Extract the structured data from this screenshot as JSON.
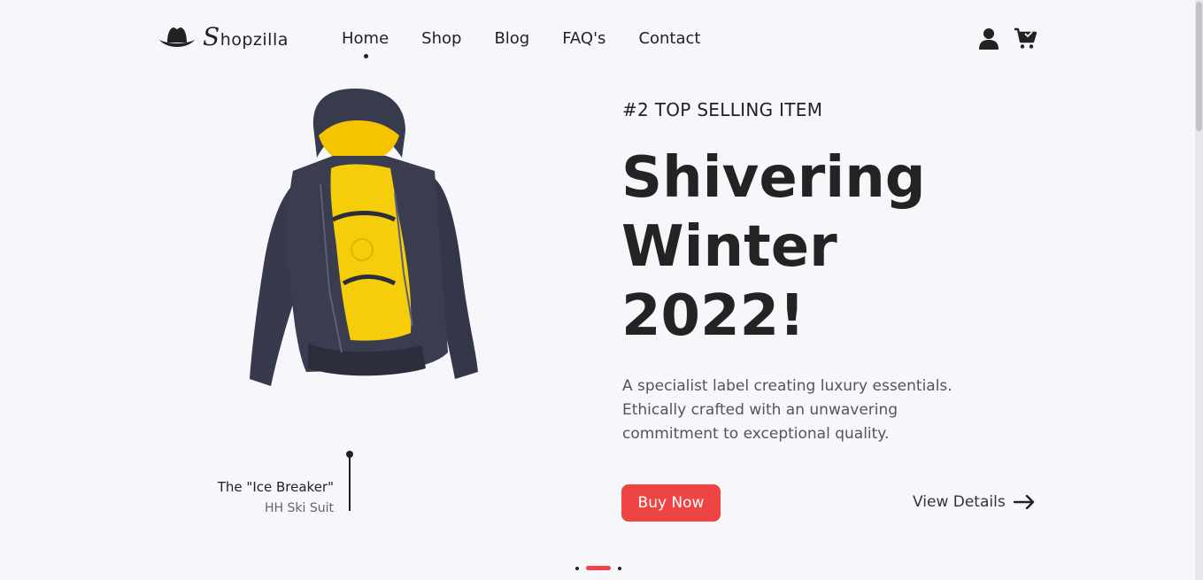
{
  "brand": {
    "logo_cap": "S",
    "logo_rest": "hopzilla"
  },
  "nav": [
    {
      "label": "Home",
      "active": true
    },
    {
      "label": "Shop",
      "active": false
    },
    {
      "label": "Blog",
      "active": false
    },
    {
      "label": "FAQ's",
      "active": false
    },
    {
      "label": "Contact",
      "active": false
    }
  ],
  "header_icons": [
    "hat-logo-icon",
    "user-icon",
    "cart-icon"
  ],
  "hero": {
    "eyebrow": "#2 TOP SELLING ITEM",
    "headline": [
      "Shivering",
      "Winter",
      "2022!"
    ],
    "description": [
      "A specialist label creating luxury essentials.",
      "Ethically crafted with an unwavering",
      "commitment to exceptional quality."
    ],
    "buy_label": "Buy Now",
    "view_label": "View Details",
    "product_name": "The \"Ice Breaker\"",
    "product_sub": "HH Ski Suit"
  },
  "carousel": {
    "slides": 3,
    "active_index": 1
  },
  "colors": {
    "accent": "#ef4444",
    "background": "#f7f7fb",
    "text": "#212121"
  }
}
